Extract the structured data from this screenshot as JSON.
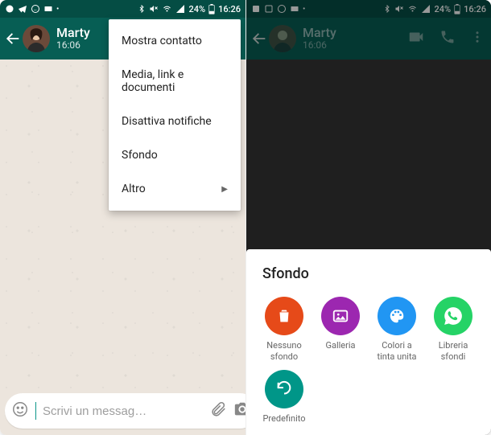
{
  "status": {
    "battery": "24%",
    "clock": "16:26"
  },
  "contact": {
    "name": "Marty",
    "lastSeen": "16:06"
  },
  "menu": {
    "items": [
      {
        "label": "Mostra contatto"
      },
      {
        "label": "Media, link e documenti"
      },
      {
        "label": "Disattiva notifiche"
      },
      {
        "label": "Sfondo"
      },
      {
        "label": "Altro",
        "hasSubmenu": true
      }
    ]
  },
  "composer": {
    "placeholder": "Scrivi un messag…"
  },
  "sheet": {
    "title": "Sfondo",
    "options": [
      {
        "label": "Nessuno\nsfondo",
        "icon": "trash",
        "color": "c-red"
      },
      {
        "label": "Galleria",
        "icon": "image",
        "color": "c-purple"
      },
      {
        "label": "Colori a\ntinta unita",
        "icon": "palette",
        "color": "c-blue"
      },
      {
        "label": "Libreria\nsfondi",
        "icon": "whatsapp",
        "color": "c-green"
      },
      {
        "label": "Predefinito",
        "icon": "undo",
        "color": "c-teal"
      }
    ]
  }
}
